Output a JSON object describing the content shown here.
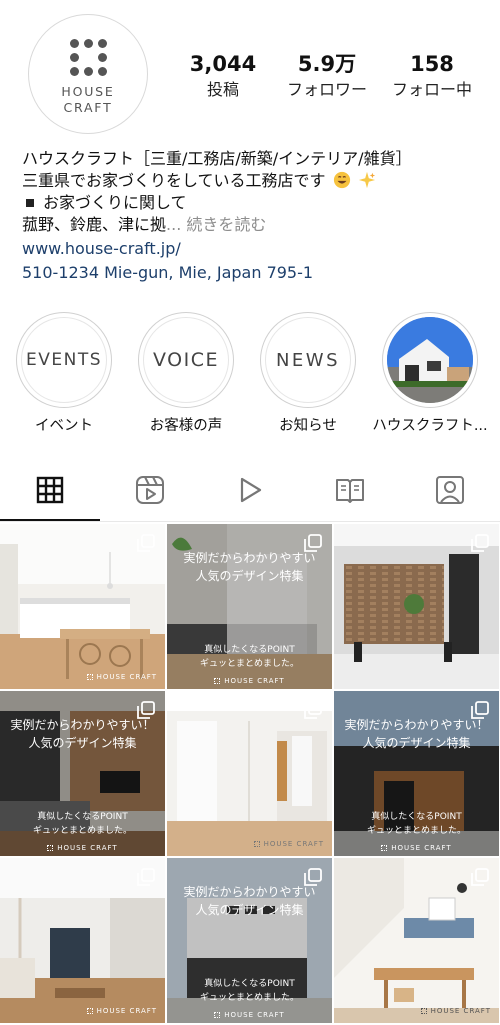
{
  "profile": {
    "logo_line1": "HOUSE",
    "logo_line2": "CRAFT",
    "stats": {
      "posts_value": "3,044",
      "posts_label": "投稿",
      "followers_value": "5.9万",
      "followers_label": "フォロワー",
      "following_value": "158",
      "following_label": "フォロー中"
    }
  },
  "bio": {
    "line1": "ハウスクラフト［三重/工務店/新築/インテリア/雑貨］",
    "line2": "三重県でお家づくりをしている工務店です",
    "line3": "お家づくりに関して",
    "line4": "菰野、鈴鹿、津に拠",
    "more": "... 続きを読む",
    "website": "www.house-craft.jp/",
    "address": "510-1234 Mie-gun, Mie, Japan 795-1"
  },
  "highlights": [
    {
      "title": "EVENTS",
      "caption": "イベント"
    },
    {
      "title": "VOICE",
      "caption": "お客様の声"
    },
    {
      "title": "NEWS",
      "caption": "お知らせ"
    },
    {
      "title": "",
      "caption": "ハウスクラフト..."
    }
  ],
  "tabs": [
    {
      "icon": "grid-icon",
      "active": true
    },
    {
      "icon": "reels-icon",
      "active": false
    },
    {
      "icon": "play-icon",
      "active": false
    },
    {
      "icon": "guide-book-icon",
      "active": false
    },
    {
      "icon": "tagged-person-icon",
      "active": false
    }
  ],
  "posts": {
    "p2": {
      "title1": "実例だからわかりやすい",
      "title2": "人気のデザイン特集",
      "sub1": "真似したくなるPOINT",
      "sub2": "ギュッとまとめました。",
      "brand": "HOUSE CRAFT"
    },
    "p4": {
      "title1": "実例だからわかりやすい！",
      "title2": "人気のデザイン特集",
      "sub1": "真似したくなるPOINT",
      "sub2": "ギュッとまとめました。",
      "brand": "HOUSE CRAFT"
    },
    "p6": {
      "title1": "実例だからわかりやすい！",
      "title2": "人気のデザイン特集",
      "sub1": "真似したくなるPOINT",
      "sub2": "ギュッとまとめました。",
      "brand": "HOUSE CRAFT"
    },
    "p8": {
      "title1": "実例だからわかりやすい",
      "title2": "人気のデザイン特集",
      "sub1": "真似したくなるPOINT",
      "sub2": "ギュッとまとめました。",
      "brand": "HOUSE CRAFT"
    },
    "brand": "HOUSE CRAFT"
  },
  "colors": {
    "link": "#1d3f6b",
    "muted": "#8e8e8e"
  }
}
